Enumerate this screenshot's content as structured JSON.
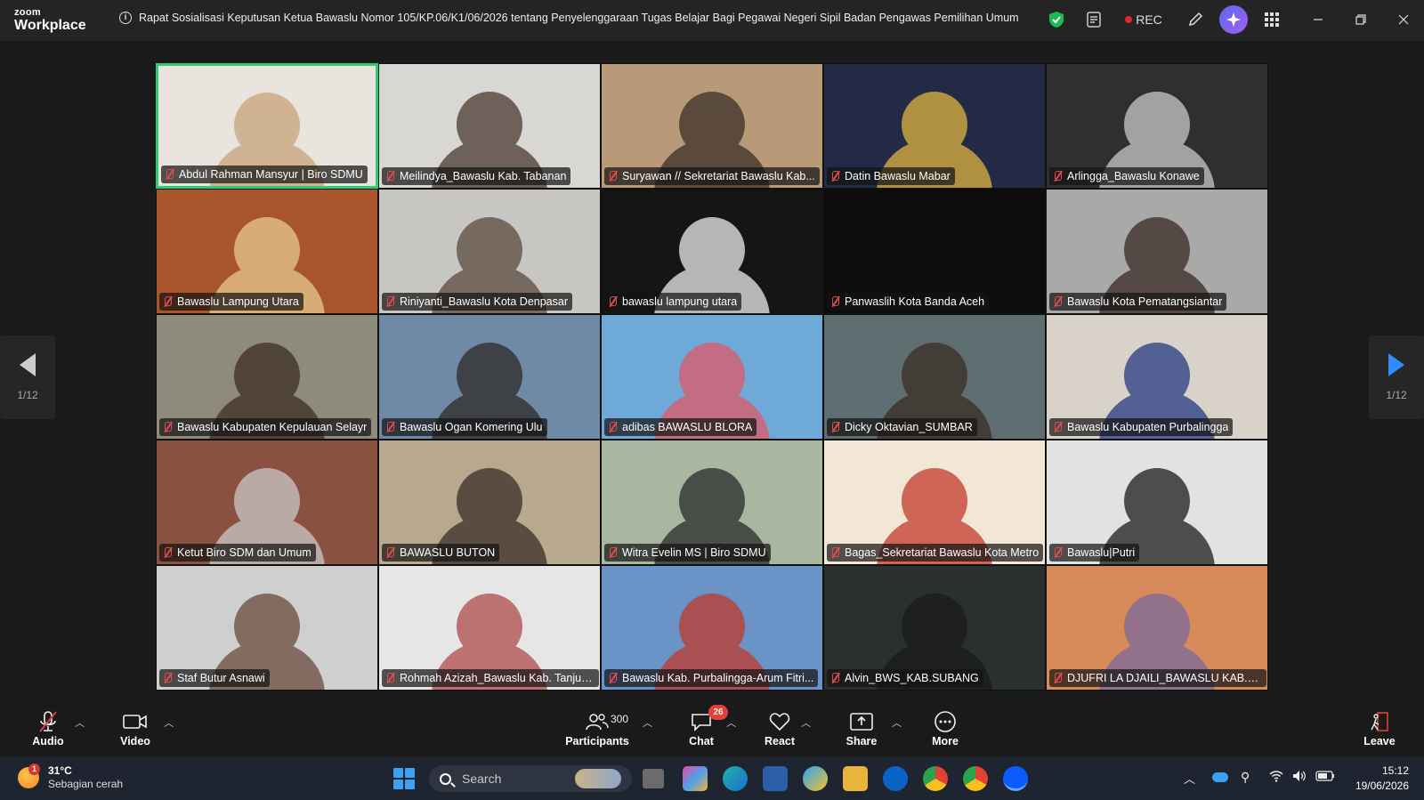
{
  "window": {
    "logo_top": "zoom",
    "logo_bottom": "Workplace",
    "meeting_title": "Rapat Sosialisasi Keputusan Ketua Bawaslu Nomor 105/KP.06/K1/06/2026 tentang Penyelenggaraan Tugas Belajar Bagi Pegawai Negeri Sipil Badan Pengawas Pemilihan Umum",
    "rec_label": "REC"
  },
  "pagination": {
    "prev": "1/12",
    "next": "1/12"
  },
  "participants": [
    {
      "name": "Abdul Rahman Mansyur | Biro SDMU",
      "bg": "#e9e4dd",
      "accent": "#c8a37a"
    },
    {
      "name": "Meilindya_Bawaslu Kab. Tabanan",
      "bg": "#d9d7d4",
      "accent": "#4a3a30"
    },
    {
      "name": "Suryawan // Sekretariat Bawaslu Kab...",
      "bg": "#b89a78",
      "accent": "#3c3028"
    },
    {
      "name": "Datin Bawaslu Mabar",
      "bg": "#222a45",
      "accent": "#e0b340"
    },
    {
      "name": "Arlingga_Bawaslu Konawe",
      "bg": "#2f2f2f",
      "accent": "#c9c9c9"
    },
    {
      "name": "Bawaslu Lampung Utara",
      "bg": "#a8552c",
      "accent": "#e8c890"
    },
    {
      "name": "Riniyanti_Bawaslu Kota Denpasar",
      "bg": "#c8c6c2",
      "accent": "#5a4a40"
    },
    {
      "name": "bawaslu lampung utara",
      "bg": "#151515",
      "accent": "#ececec"
    },
    {
      "name": "Panwaslih Kota Banda Aceh",
      "bg": "#0c0c0c",
      "accent": "#0c0c0c"
    },
    {
      "name": "Bawaslu Kota Pematangsiantar",
      "bg": "#a9a9a9",
      "accent": "#3a2a25"
    },
    {
      "name": "Bawaslu Kabupaten Kepulauan Selayr",
      "bg": "#8e8a7c",
      "accent": "#3d2d23"
    },
    {
      "name": "Bawaslu Ogan Komering Ulu",
      "bg": "#6f8aa6",
      "accent": "#2e2a28"
    },
    {
      "name": "adibas BAWASLU BLORA",
      "bg": "#6fa9d8",
      "accent": "#e05a6a"
    },
    {
      "name": "Dicky Oktavian_SUMBAR",
      "bg": "#5f6e70",
      "accent": "#3a2d25"
    },
    {
      "name": "Bawaslu Kabupaten Purbalingga",
      "bg": "#d8d2c8",
      "accent": "#263a82"
    },
    {
      "name": "Ketut Biro SDM dan Umum",
      "bg": "#8a5040",
      "accent": "#c9c9c9"
    },
    {
      "name": "BAWASLU BUTON",
      "bg": "#b8a88e",
      "accent": "#3a2e28"
    },
    {
      "name": "Witra Evelin MS | Biro SDMU",
      "bg": "#a9b7a0",
      "accent": "#2a2a2a"
    },
    {
      "name": "Bagas_Sekretariat Bawaslu Kota Metro",
      "bg": "#f2e6d4",
      "accent": "#c23a2e"
    },
    {
      "name": "Bawaslu|Putri",
      "bg": "#e2e2e2",
      "accent": "#1c1c1c"
    },
    {
      "name": "Staf Butur Asnawi",
      "bg": "#cfcfcf",
      "accent": "#6a4a3a"
    },
    {
      "name": "Rohmah Azizah_Bawaslu Kab. Tanjun...",
      "bg": "#e6e6e6",
      "accent": "#b04a4a"
    },
    {
      "name": "Bawaslu Kab. Purbalingga-Arum Fitri...",
      "bg": "#6a94c8",
      "accent": "#c0392b"
    },
    {
      "name": "Alvin_BWS_KAB.SUBANG",
      "bg": "#2a3030",
      "accent": "#1a1a1a"
    },
    {
      "name": "DJUFRI LA DJAILI_BAWASLU KAB.KAI...",
      "bg": "#d88a5a",
      "accent": "#7a6a9a"
    }
  ],
  "toolbar": {
    "audio": "Audio",
    "video": "Video",
    "participants": "Participants",
    "participants_count": "300",
    "chat": "Chat",
    "chat_badge": "26",
    "react": "React",
    "share": "Share",
    "more": "More",
    "leave": "Leave"
  },
  "taskbar": {
    "weather_temp": "31°C",
    "weather_desc": "Sebagian cerah",
    "weather_alert": "1",
    "search_placeholder": "Search",
    "time": "15:12",
    "date": "19/06/2026"
  }
}
